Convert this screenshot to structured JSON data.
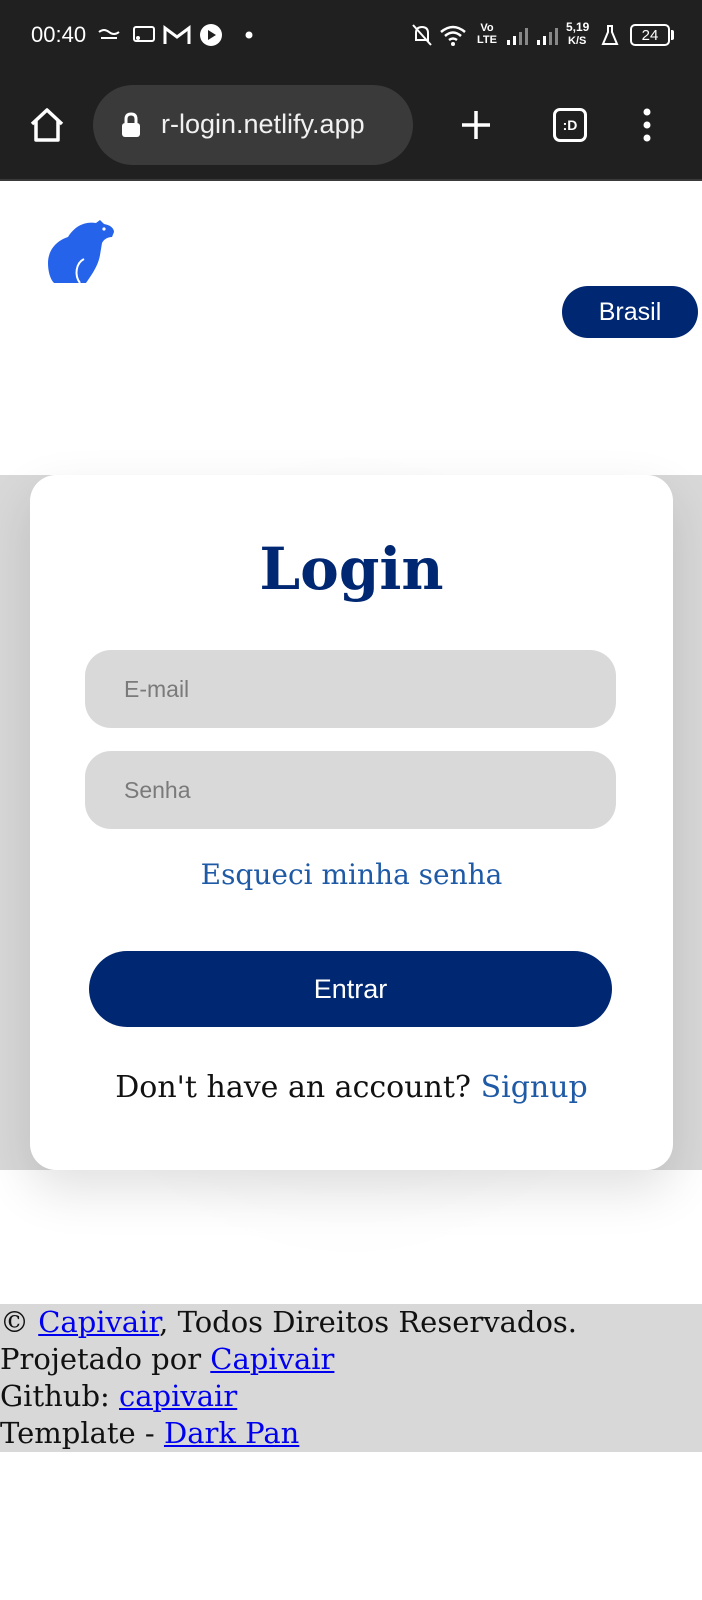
{
  "status_bar": {
    "time": "00:40",
    "network_lte": "Vo LTE",
    "speed_value": "5,19",
    "speed_unit": "K/S",
    "battery": "24"
  },
  "browser": {
    "url": "r-login.netlify.app",
    "tabs_label": ":D"
  },
  "header": {
    "country_button": "Brasil"
  },
  "login": {
    "title": "Login",
    "email_placeholder": "E-mail",
    "password_placeholder": "Senha",
    "forgot_password": "Esqueci minha senha",
    "submit": "Entrar",
    "signup_prompt": "Don't have an account?",
    "signup_link": "Signup"
  },
  "footer": {
    "copyright_symbol": "©",
    "copyright_link": "Capivair",
    "copyright_text": ", Todos Direitos Reservados.",
    "designed_by_text": "Projetado por",
    "designed_by_link": "Capivair",
    "github_text": "Github:",
    "github_link": "capivair",
    "template_text": "Template -",
    "template_link": "Dark Pan"
  },
  "colors": {
    "primary": "#002771",
    "link": "#1e5aa6",
    "field_bg": "#d9d9d9",
    "band_bg": "#d8d8d8"
  }
}
